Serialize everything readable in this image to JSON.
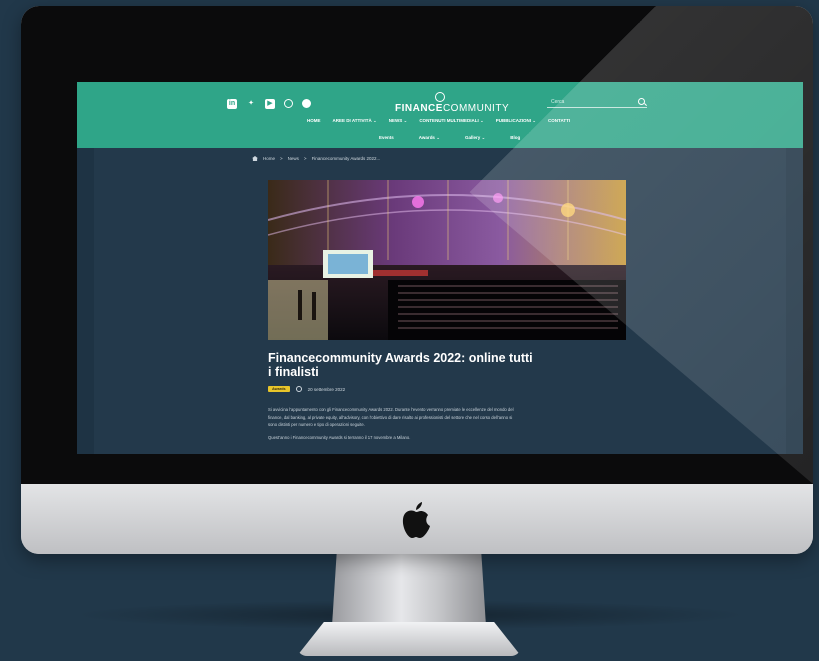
{
  "site": {
    "logo_bold": "FINANCE",
    "logo_light": "COMMUNITY",
    "search_placeholder": "Cerca",
    "social_icons": [
      "linkedin-icon",
      "twitter-icon",
      "youtube-icon",
      "instagram-icon",
      "facebook-icon"
    ],
    "nav_primary": [
      {
        "label": "HOME"
      },
      {
        "label": "AREE DI ATTIVITÀ ⌄"
      },
      {
        "label": "NEWS ⌄"
      },
      {
        "label": "CONTENUTI MULTIMEDIALI ⌄"
      },
      {
        "label": "PUBBLICAZIONI ⌄"
      },
      {
        "label": "CONTATTI"
      }
    ],
    "nav_secondary": [
      {
        "label": "Events"
      },
      {
        "label": "Awards ⌄"
      },
      {
        "label": "Gallery ⌄"
      },
      {
        "label": "Blog"
      }
    ],
    "colors": {
      "header": "#2fa588",
      "page": "#23394b",
      "badge": "#e8c52a"
    }
  },
  "breadcrumb": {
    "home": "Home",
    "sep": ">",
    "news": "News",
    "current": "Financecommunity Awards 2022..."
  },
  "article": {
    "title": "Financecommunity Awards 2022: online tutti i finalisti",
    "badge": "Awards",
    "date": "20 settembre 2022",
    "paragraph1": "Si avvicina l’appuntamento con gli Financecommunity Awards 2022. Durante l’evento verranno premiate le eccellenze del mondo del finance, dal banking, al private equity, all’advisory, con l’obiettivo di dare risalto ai professionisti del settore che nel corso dell’anno si sono distinti per numero e tipo di operazioni seguite.",
    "paragraph2": "Quest’anno i Financecommunity Awards si terranno il 17 novembre a Milano."
  }
}
